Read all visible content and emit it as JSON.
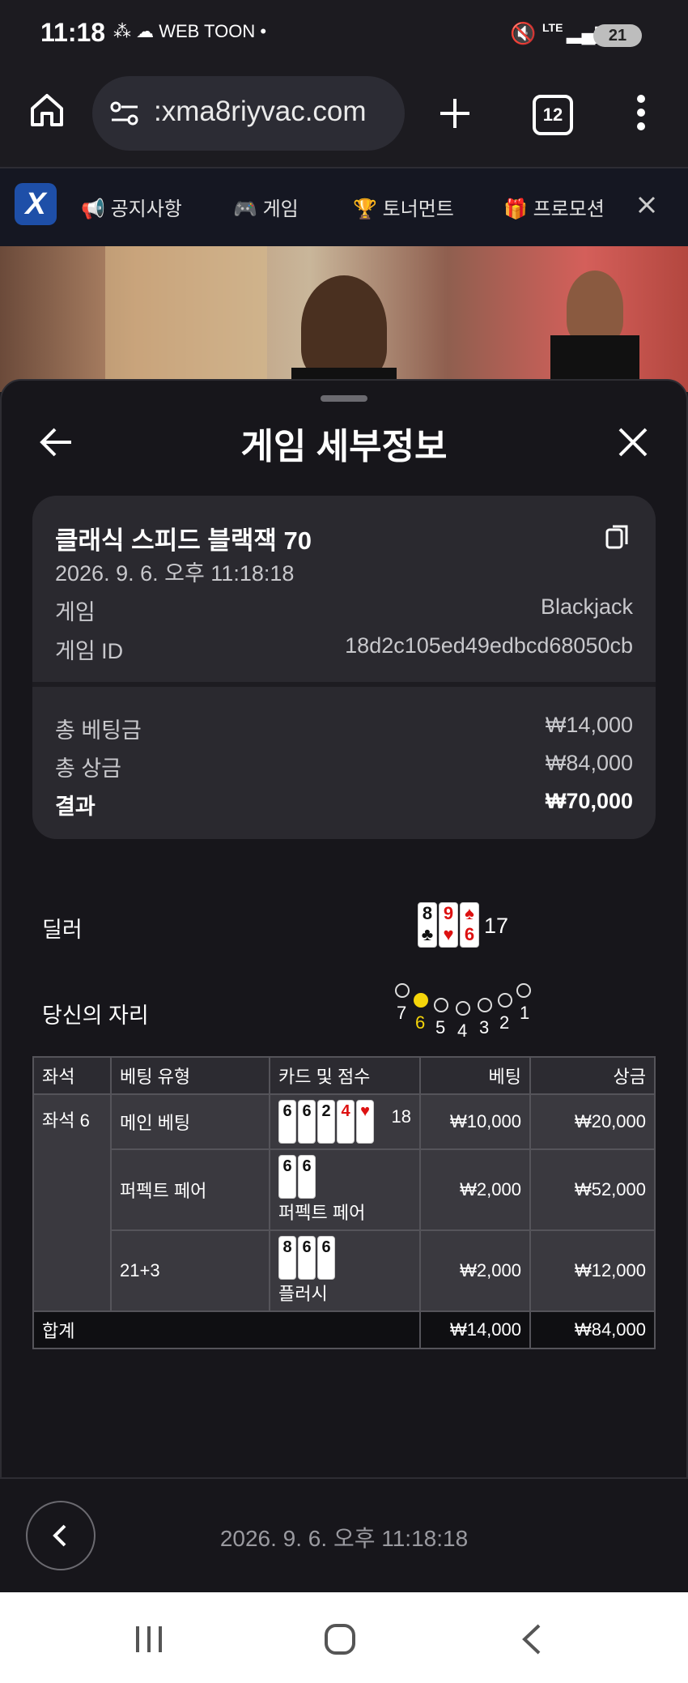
{
  "status": {
    "time": "11:18",
    "battery": "21",
    "icons_left": "⁂ ☁ WEB TOON •",
    "lte": "LTE"
  },
  "browser": {
    "url": ":xma8riyvac.com",
    "tab_count": "12"
  },
  "nav": {
    "items": [
      "공지사항",
      "게임",
      "토너먼트",
      "프로모션"
    ]
  },
  "sheet": {
    "title": "게임 세부정보",
    "game_name": "클래식 스피드 블랙잭 70",
    "datetime": "2026. 9. 6. 오후 11:18:18",
    "game_label": "게임",
    "game_value": "Blackjack",
    "game_id_label": "게임 ID",
    "game_id_value": "18d2c105ed49edbcd68050cb",
    "total_bet_label": "총 베팅금",
    "total_bet_value": "₩14,000",
    "total_win_label": "총 상금",
    "total_win_value": "₩84,000",
    "result_label": "결과",
    "result_value": "₩70,000",
    "dealer_label": "딜러",
    "dealer_cards": [
      {
        "rank": "8",
        "suit": "♣",
        "color": "black"
      },
      {
        "rank": "9",
        "suit": "♥",
        "color": "red"
      },
      {
        "rank": "6",
        "suit": "♠",
        "color": "red"
      }
    ],
    "dealer_score": "17",
    "your_seat_label": "당신의 자리",
    "seats": [
      "7",
      "6",
      "5",
      "4",
      "3",
      "2",
      "1"
    ],
    "active_seat": "6"
  },
  "table": {
    "headers": [
      "좌석",
      "베팅 유형",
      "카드 및 점수",
      "베팅",
      "상금"
    ],
    "seat": "좌석 6",
    "rows": [
      {
        "type": "메인 베팅",
        "cards": [
          "6",
          "6",
          "2",
          "4",
          "♥"
        ],
        "score": "18",
        "sub": "",
        "bet": "₩10,000",
        "win": "₩20,000"
      },
      {
        "type": "퍼펙트 페어",
        "cards": [
          "6",
          "6"
        ],
        "score": "",
        "sub": "퍼펙트 페어",
        "bet": "₩2,000",
        "win": "₩52,000"
      },
      {
        "type": "21+3",
        "cards": [
          "8",
          "6",
          "6"
        ],
        "score": "",
        "sub": "플러시",
        "bet": "₩2,000",
        "win": "₩12,000"
      }
    ],
    "total_label": "합계",
    "total_bet": "₩14,000",
    "total_win": "₩84,000"
  },
  "footer": {
    "datetime": "2026. 9. 6. 오후 11:18:18"
  },
  "colors": {
    "accent_seat": "#f5d50a",
    "sheet_bg": "#17161b",
    "card_bg": "#2a292f"
  }
}
